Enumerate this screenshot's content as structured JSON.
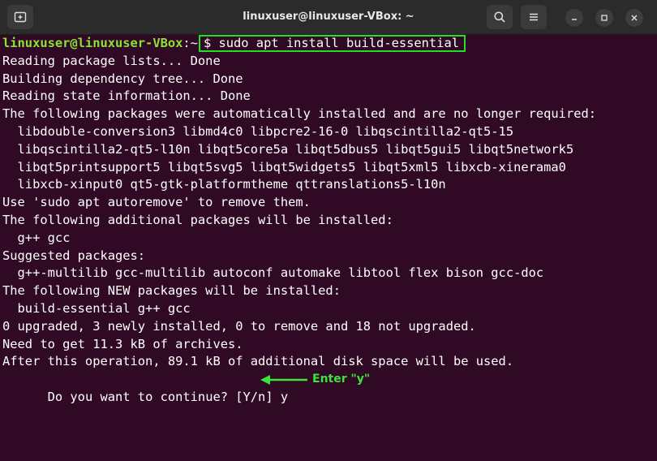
{
  "window": {
    "title": "linuxuser@linuxuser-VBox: ~",
    "colors": {
      "terminal_bg": "#300a24",
      "titlebar_bg": "#2b2b2b",
      "prompt_green": "#8ae234",
      "highlight_green": "#22e022"
    },
    "icons": [
      "new-tab-icon",
      "search-icon",
      "menu-icon",
      "minimize-icon",
      "maximize-icon",
      "close-icon"
    ]
  },
  "terminal": {
    "prompt_user": "linuxuser@linuxuser-VBox",
    "prompt_sep": ":~",
    "command": "$ sudo apt install build-essential",
    "lines": [
      "Reading package lists... Done",
      "Building dependency tree... Done",
      "Reading state information... Done",
      "The following packages were automatically installed and are no longer required:",
      "  libdouble-conversion3 libmd4c0 libpcre2-16-0 libqscintilla2-qt5-15",
      "  libqscintilla2-qt5-l10n libqt5core5a libqt5dbus5 libqt5gui5 libqt5network5",
      "  libqt5printsupport5 libqt5svg5 libqt5widgets5 libqt5xml5 libxcb-xinerama0",
      "  libxcb-xinput0 qt5-gtk-platformtheme qttranslations5-l10n",
      "Use 'sudo apt autoremove' to remove them.",
      "The following additional packages will be installed:",
      "  g++ gcc",
      "Suggested packages:",
      "  g++-multilib gcc-multilib autoconf automake libtool flex bison gcc-doc",
      "The following NEW packages will be installed:",
      "  build-essential g++ gcc",
      "0 upgraded, 3 newly installed, 0 to remove and 18 not upgraded.",
      "Need to get 11.3 kB of archives.",
      "After this operation, 89.1 kB of additional disk space will be used."
    ],
    "last_line": "Do you want to continue? [Y/n] y",
    "annotation": "Enter \"y\""
  }
}
